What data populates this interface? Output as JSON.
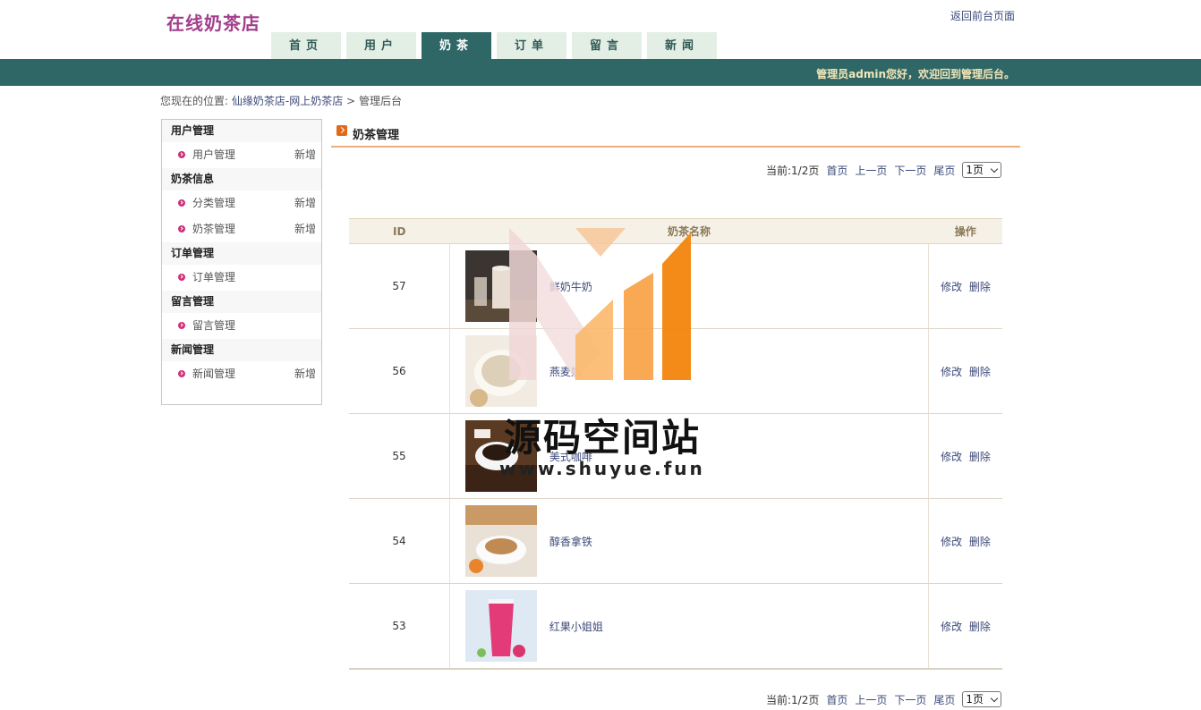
{
  "site": {
    "title": "在线奶茶店",
    "return_link": "返回前台页面"
  },
  "tabs": [
    {
      "label": "首页"
    },
    {
      "label": "用户"
    },
    {
      "label": "奶茶"
    },
    {
      "label": "订单"
    },
    {
      "label": "留言"
    },
    {
      "label": "新闻"
    }
  ],
  "active_tab": "奶茶",
  "welcome": "管理员admin您好，欢迎回到管理后台。",
  "breadcrumb": {
    "prefix": "您现在的位置:",
    "link": "仙缘奶茶店-网上奶茶店",
    "sep": ">",
    "current": "管理后台"
  },
  "sidebar": {
    "groups": [
      {
        "title": "用户管理",
        "items": [
          {
            "label": "用户管理",
            "add": "新增"
          }
        ]
      },
      {
        "title": "奶茶信息",
        "items": [
          {
            "label": "分类管理",
            "add": "新增"
          },
          {
            "label": "奶茶管理",
            "add": "新增"
          }
        ]
      },
      {
        "title": "订单管理",
        "items": [
          {
            "label": "订单管理"
          }
        ]
      },
      {
        "title": "留言管理",
        "items": [
          {
            "label": "留言管理"
          }
        ]
      },
      {
        "title": "新闻管理",
        "items": [
          {
            "label": "新闻管理",
            "add": "新增"
          }
        ]
      }
    ]
  },
  "content": {
    "title": "奶茶管理"
  },
  "pager": {
    "status": "当前:1/2页",
    "first": "首页",
    "prev": "上一页",
    "next": "下一页",
    "last": "尾页",
    "select": "1页"
  },
  "table": {
    "headers": {
      "id": "ID",
      "name": "奶茶名称",
      "ops": "操作"
    },
    "rows": [
      {
        "id": "57",
        "name": "鲜奶牛奶",
        "edit": "修改",
        "del": "删除"
      },
      {
        "id": "56",
        "name": "燕麦奶",
        "edit": "修改",
        "del": "删除"
      },
      {
        "id": "55",
        "name": "美式咖啡",
        "edit": "修改",
        "del": "删除"
      },
      {
        "id": "54",
        "name": "醇香拿铁",
        "edit": "修改",
        "del": "删除"
      },
      {
        "id": "53",
        "name": "红果小姐姐",
        "edit": "修改",
        "del": "删除"
      }
    ]
  },
  "watermark": {
    "text": "源码空间站",
    "url": "www.shuyue.fun"
  }
}
